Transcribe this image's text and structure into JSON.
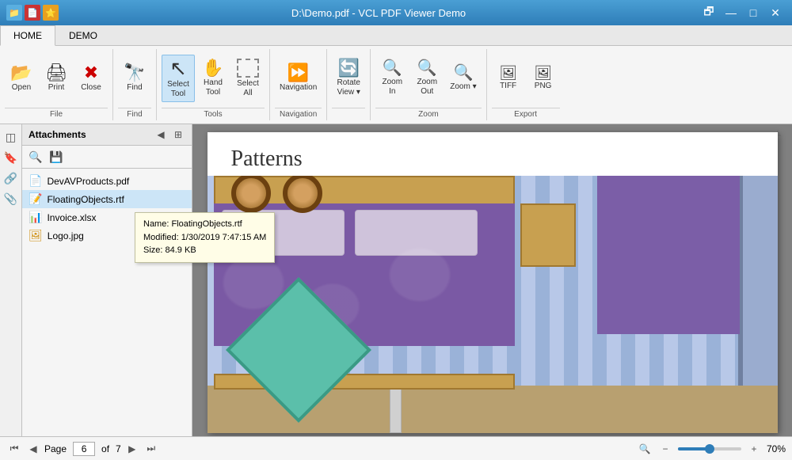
{
  "titlebar": {
    "title": "D:\\Demo.pdf - VCL PDF Viewer Demo",
    "icons": [
      "folder",
      "pdf",
      "star"
    ],
    "controls": [
      "restore",
      "minimize",
      "maximize",
      "close"
    ]
  },
  "ribbon": {
    "tabs": [
      {
        "label": "HOME",
        "active": true
      },
      {
        "label": "DEMO",
        "active": false
      }
    ],
    "groups": [
      {
        "name": "file",
        "label": "File",
        "buttons": [
          {
            "id": "open",
            "icon": "📂",
            "label": "Open"
          },
          {
            "id": "print",
            "icon": "🖨",
            "label": "Print"
          },
          {
            "id": "close",
            "icon": "❌",
            "label": "Close"
          }
        ]
      },
      {
        "name": "find",
        "label": "Find",
        "buttons": [
          {
            "id": "find",
            "icon": "🔭",
            "label": "Find"
          }
        ]
      },
      {
        "name": "tools",
        "label": "Tools",
        "buttons": [
          {
            "id": "select-tool",
            "icon": "↖",
            "label": "Select\nTool",
            "active": true
          },
          {
            "id": "hand-tool",
            "icon": "✋",
            "label": "Hand\nTool"
          },
          {
            "id": "select-all",
            "icon": "⬜",
            "label": "Select\nAll"
          }
        ]
      },
      {
        "name": "navigation",
        "label": "Navigation",
        "buttons": [
          {
            "id": "navigation",
            "icon": "▶",
            "label": "Navigation"
          }
        ]
      },
      {
        "name": "rotate",
        "label": "",
        "buttons": [
          {
            "id": "rotate-view",
            "icon": "🔄",
            "label": "Rotate\nView ▾"
          }
        ]
      },
      {
        "name": "zoom",
        "label": "Zoom",
        "buttons": [
          {
            "id": "zoom-in",
            "icon": "🔍+",
            "label": "Zoom\nIn"
          },
          {
            "id": "zoom-out",
            "icon": "🔍-",
            "label": "Zoom\nOut"
          },
          {
            "id": "zoom",
            "icon": "🔍",
            "label": "Zoom ▾"
          }
        ]
      },
      {
        "name": "export",
        "label": "Export",
        "buttons": [
          {
            "id": "tiff",
            "icon": "📄",
            "label": "TIFF"
          },
          {
            "id": "png",
            "icon": "📄",
            "label": "PNG"
          }
        ]
      }
    ]
  },
  "sidebar": {
    "title": "Attachments",
    "files": [
      {
        "name": "DevAVProducts.pdf",
        "type": "pdf"
      },
      {
        "name": "FloatingObjects.rtf",
        "type": "rtf",
        "selected": true
      },
      {
        "name": "Invoice.xlsx",
        "type": "xlsx"
      },
      {
        "name": "Logo.jpg",
        "type": "jpg"
      }
    ],
    "tooltip": {
      "name": "Name: FloatingObjects.rtf",
      "modified": "Modified: 1/30/2019 7:47:15 AM",
      "size": "Size: 84.9 KB"
    }
  },
  "pdf": {
    "title": "Patterns",
    "current_page": "6",
    "total_pages": "7",
    "zoom": "70%"
  },
  "statusbar": {
    "page_label": "Page",
    "of_label": "of",
    "zoom_label": "70%",
    "nav_buttons": [
      "first",
      "prev",
      "next",
      "last"
    ],
    "zoom_minus": "−",
    "zoom_plus": "+"
  }
}
